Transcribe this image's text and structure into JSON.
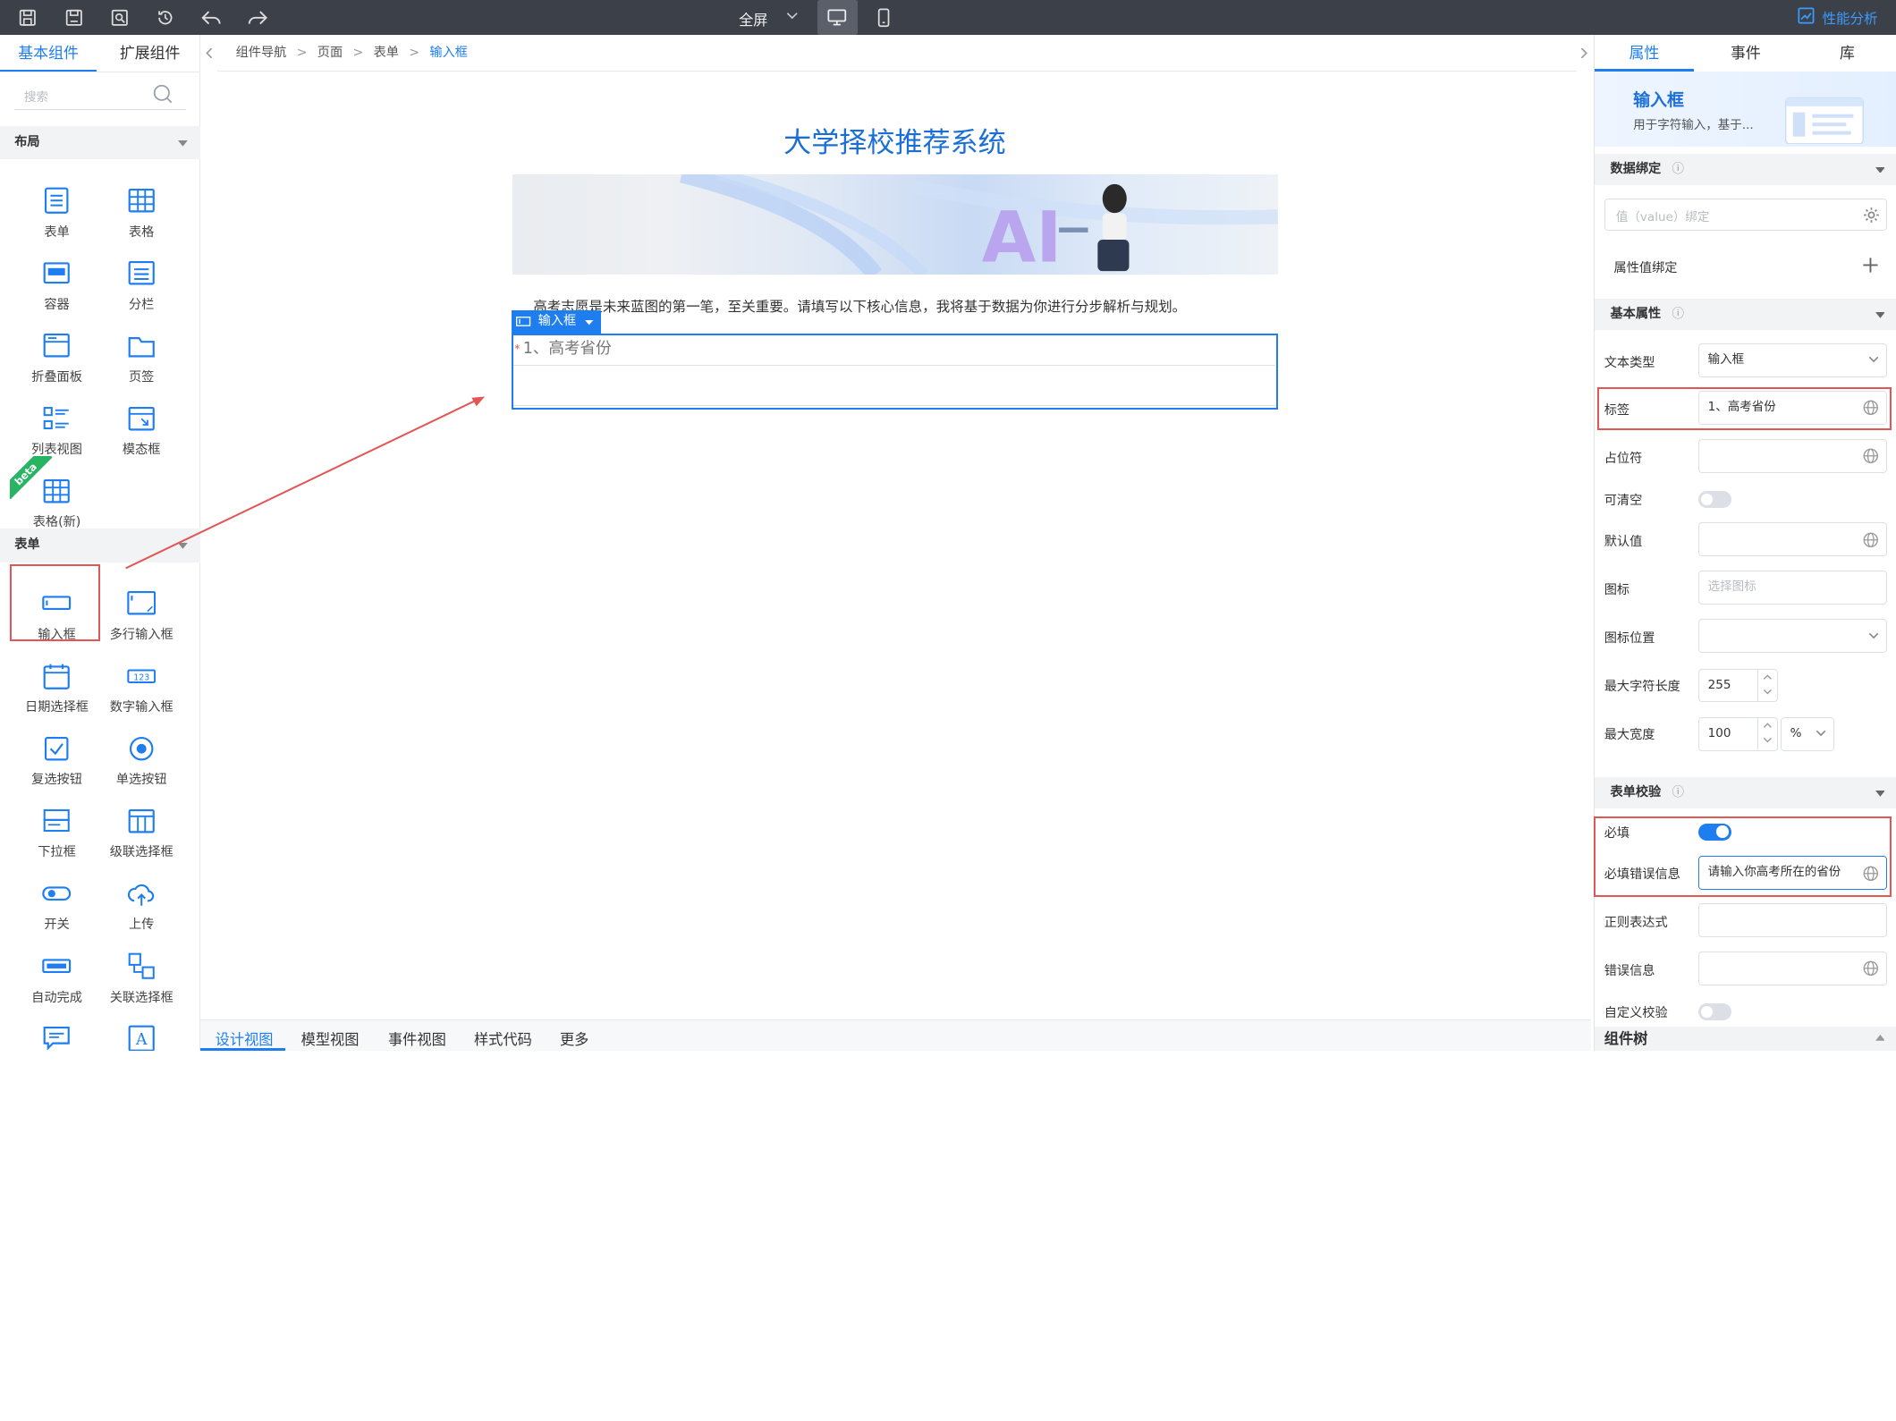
{
  "toolbar": {
    "view_mode": "全屏",
    "perf_label": "性能分析"
  },
  "left": {
    "tabs": [
      "基本组件",
      "扩展组件"
    ],
    "search_placeholder": "搜索",
    "layout_section": "布局",
    "layout_items": [
      "表单",
      "表格",
      "容器",
      "分栏",
      "折叠面板",
      "页签",
      "列表视图",
      "模态框",
      "表格(新)"
    ],
    "beta": "beta",
    "form_section": "表单",
    "form_items": [
      "输入框",
      "多行输入框",
      "日期选择框",
      "数字输入框",
      "复选按钮",
      "单选按钮",
      "下拉框",
      "级联选择框",
      "开关",
      "上传",
      "自动完成",
      "关联选择框"
    ]
  },
  "canvas": {
    "breadcrumb": [
      "组件导航",
      "页面",
      "表单",
      "输入框"
    ],
    "title": "大学择校推荐系统",
    "intro": "高考志愿是未来蓝图的第一笔，至关重要。请填写以下核心信息，我将基于数据为你进行分步解析与规划。",
    "selected_tag": "输入框",
    "required_mark": "*",
    "field_label": "1、高考省份",
    "bottom_tabs": [
      "设计视图",
      "模型视图",
      "事件视图",
      "样式代码",
      "更多"
    ]
  },
  "right": {
    "tabs": [
      "属性",
      "事件",
      "库"
    ],
    "component_name": "输入框",
    "component_desc": "用于字符输入，基于...",
    "data_binding": {
      "title": "数据绑定",
      "value_placeholder": "值（value）绑定",
      "prop_binding": "属性值绑定"
    },
    "basic": {
      "title": "基本属性",
      "text_type_label": "文本类型",
      "text_type_value": "输入框",
      "label_label": "标签",
      "label_value": "1、高考省份",
      "placeholder_label": "占位符",
      "clearable_label": "可清空",
      "default_label": "默认值",
      "icon_label": "图标",
      "icon_placeholder": "选择图标",
      "icon_pos_label": "图标位置",
      "maxlen_label": "最大字符长度",
      "maxlen_value": "255",
      "maxwidth_label": "最大宽度",
      "maxwidth_value": "100",
      "maxwidth_unit": "%"
    },
    "validation": {
      "title": "表单校验",
      "required_label": "必填",
      "required_msg_label": "必填错误信息",
      "required_msg_value": "请输入你高考所在的省份",
      "regex_label": "正则表达式",
      "error_label": "错误信息",
      "custom_label": "自定义校验"
    },
    "tree_title": "组件树"
  },
  "colors": {
    "accent": "#1e7ef0",
    "topbar": "#3c4049",
    "highlight": "#e35656"
  }
}
